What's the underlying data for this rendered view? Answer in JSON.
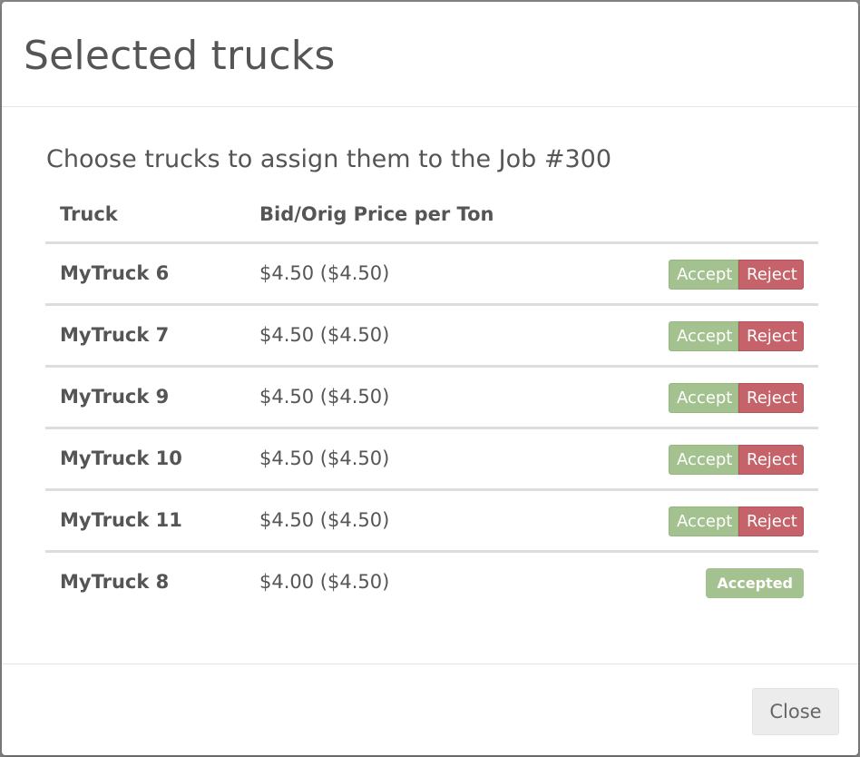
{
  "modal": {
    "title": "Selected trucks",
    "subtitle": "Choose trucks to assign them to the Job #300",
    "close_label": "Close"
  },
  "table": {
    "headers": {
      "truck": "Truck",
      "price": "Bid/Orig Price per Ton"
    },
    "rows": [
      {
        "truck": "MyTruck 6",
        "price": "$4.50 ($4.50)",
        "status": "pending"
      },
      {
        "truck": "MyTruck 7",
        "price": "$4.50 ($4.50)",
        "status": "pending"
      },
      {
        "truck": "MyTruck 9",
        "price": "$4.50 ($4.50)",
        "status": "pending"
      },
      {
        "truck": "MyTruck 10",
        "price": "$4.50 ($4.50)",
        "status": "pending"
      },
      {
        "truck": "MyTruck 11",
        "price": "$4.50 ($4.50)",
        "status": "pending"
      },
      {
        "truck": "MyTruck 8",
        "price": "$4.00 ($4.50)",
        "status": "accepted"
      }
    ]
  },
  "buttons": {
    "accept": "Accept",
    "reject": "Reject",
    "accepted": "Accepted"
  },
  "colors": {
    "accept": "#a3c28f",
    "reject": "#c5626a",
    "text": "#555555",
    "close_bg": "#ececec"
  }
}
